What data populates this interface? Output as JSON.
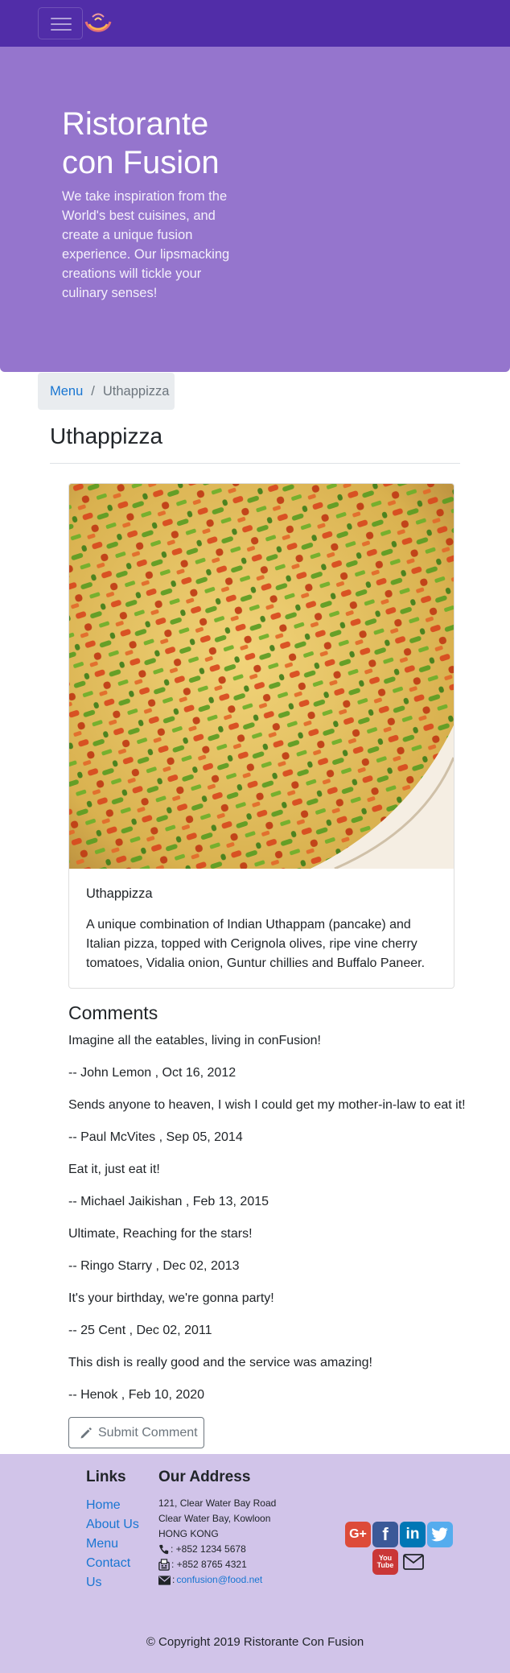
{
  "nav": {
    "toggler_icon": "hamburger-icon",
    "logo_icon": "restaurant-logo"
  },
  "jumbotron": {
    "title": "Ristorante con Fusion",
    "description": "We take inspiration from the World's best cuisines, and create a unique fusion experience. Our lipsmacking creations will tickle your culinary senses!"
  },
  "breadcrumb": {
    "menu_label": "Menu",
    "separator": "/",
    "current": "Uthappizza"
  },
  "dish": {
    "heading": "Uthappizza",
    "name": "Uthappizza",
    "description": "A unique combination of Indian Uthappam (pancake) and Italian pizza, topped with Cerignola olives, ripe vine cherry tomatoes, Vidalia onion, Guntur chillies and Buffalo Paneer."
  },
  "comments": {
    "heading": "Comments",
    "items": [
      {
        "text": "Imagine all the eatables, living in conFusion!",
        "byline": "-- John Lemon , Oct 16, 2012"
      },
      {
        "text": "Sends anyone to heaven, I wish I could get my mother-in-law to eat it!",
        "byline": "-- Paul McVites , Sep 05, 2014"
      },
      {
        "text": "Eat it, just eat it!",
        "byline": "-- Michael Jaikishan , Feb 13, 2015"
      },
      {
        "text": "Ultimate, Reaching for the stars!",
        "byline": "-- Ringo Starry , Dec 02, 2013"
      },
      {
        "text": "It's your birthday, we're gonna party!",
        "byline": "-- 25 Cent , Dec 02, 2011"
      },
      {
        "text": "This dish is really good and the service was amazing!",
        "byline": "-- Henok , Feb 10, 2020"
      }
    ],
    "submit_label": "Submit Comment",
    "submit_icon": "pencil-icon"
  },
  "footer": {
    "links_heading": "Links",
    "links": [
      "Home",
      "About Us",
      "Menu",
      "Contact Us"
    ],
    "address_heading": "Our Address",
    "address_lines": [
      "121, Clear Water Bay Road",
      "Clear Water Bay, Kowloon",
      "HONG KONG"
    ],
    "phone": ": +852 1234 5678",
    "fax": ": +852 8765 4321",
    "email_prefix": ": ",
    "email": "confusion@food.net",
    "social": {
      "google_label": "G+",
      "facebook_label": "f",
      "linkedin_label": "in",
      "youtube_label": "You Tube"
    },
    "copyright": "© Copyright 2019 Ristorante Con Fusion"
  },
  "colors": {
    "navbar": "#512da8",
    "jumbotron": "#9575cd",
    "footer": "#d1c4e9",
    "link": "#1976d2",
    "google": "#dd4b39",
    "facebook": "#3b5998",
    "linkedin": "#0077b5",
    "twitter": "#55acee",
    "youtube": "#ca3737"
  }
}
